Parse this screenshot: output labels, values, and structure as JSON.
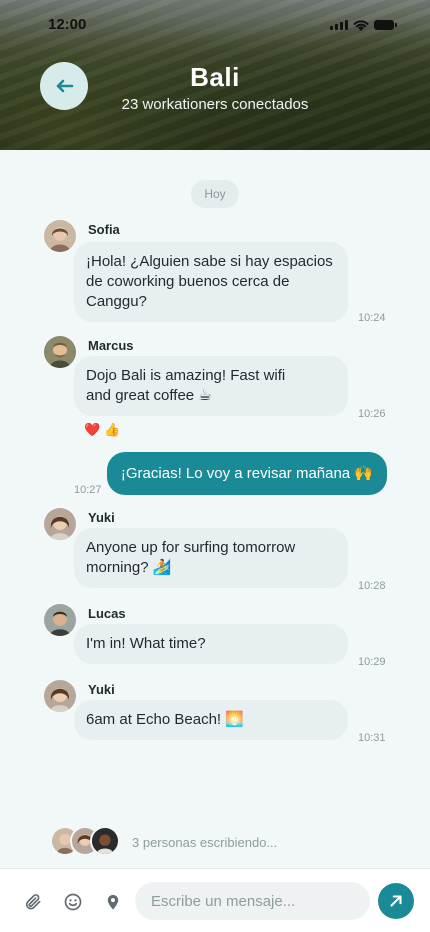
{
  "status_bar": {
    "time": "12:00"
  },
  "header": {
    "title": "Bali",
    "subtitle": "23 workationers conectados"
  },
  "chat": {
    "day_label": "Hoy",
    "messages": [
      {
        "sender": "Sofia",
        "lines": [
          "¡Hola! ¿Alguien sabe si hay espacios",
          "de coworking buenos cerca de",
          "Canggu?"
        ],
        "time": "10:24"
      },
      {
        "sender": "Marcus",
        "lines": [
          "Dojo Bali is amazing! Fast wifi",
          "and great coffee ☕"
        ],
        "time": "10:26",
        "reactions": [
          "❤️",
          "👍"
        ]
      },
      {
        "sender": "",
        "lines": [
          "¡Gracias! Lo voy a revisar mañana 🙌"
        ],
        "time": "10:27",
        "outgoing": true
      },
      {
        "sender": "Yuki",
        "lines": [
          "Anyone up for surfing tomorrow",
          "morning? 🏄"
        ],
        "time": "10:28"
      },
      {
        "sender": "Lucas",
        "lines": [
          "I'm in! What time?"
        ],
        "time": "10:29"
      },
      {
        "sender": "Yuki",
        "lines": [
          "6am at Echo Beach! 🌅"
        ],
        "time": "10:31"
      }
    ],
    "typing_text": "3 personas escribiendo..."
  },
  "composer": {
    "placeholder": "Escribe un mensaje...",
    "value": ""
  },
  "colors": {
    "accent": "#1a8a97",
    "incoming_bubble": "#e7eff1",
    "background": "#f2f7f7"
  },
  "icons": [
    "back-arrow-icon",
    "paperclip-icon",
    "emoji-icon",
    "location-pin-icon",
    "send-arrow-icon"
  ]
}
